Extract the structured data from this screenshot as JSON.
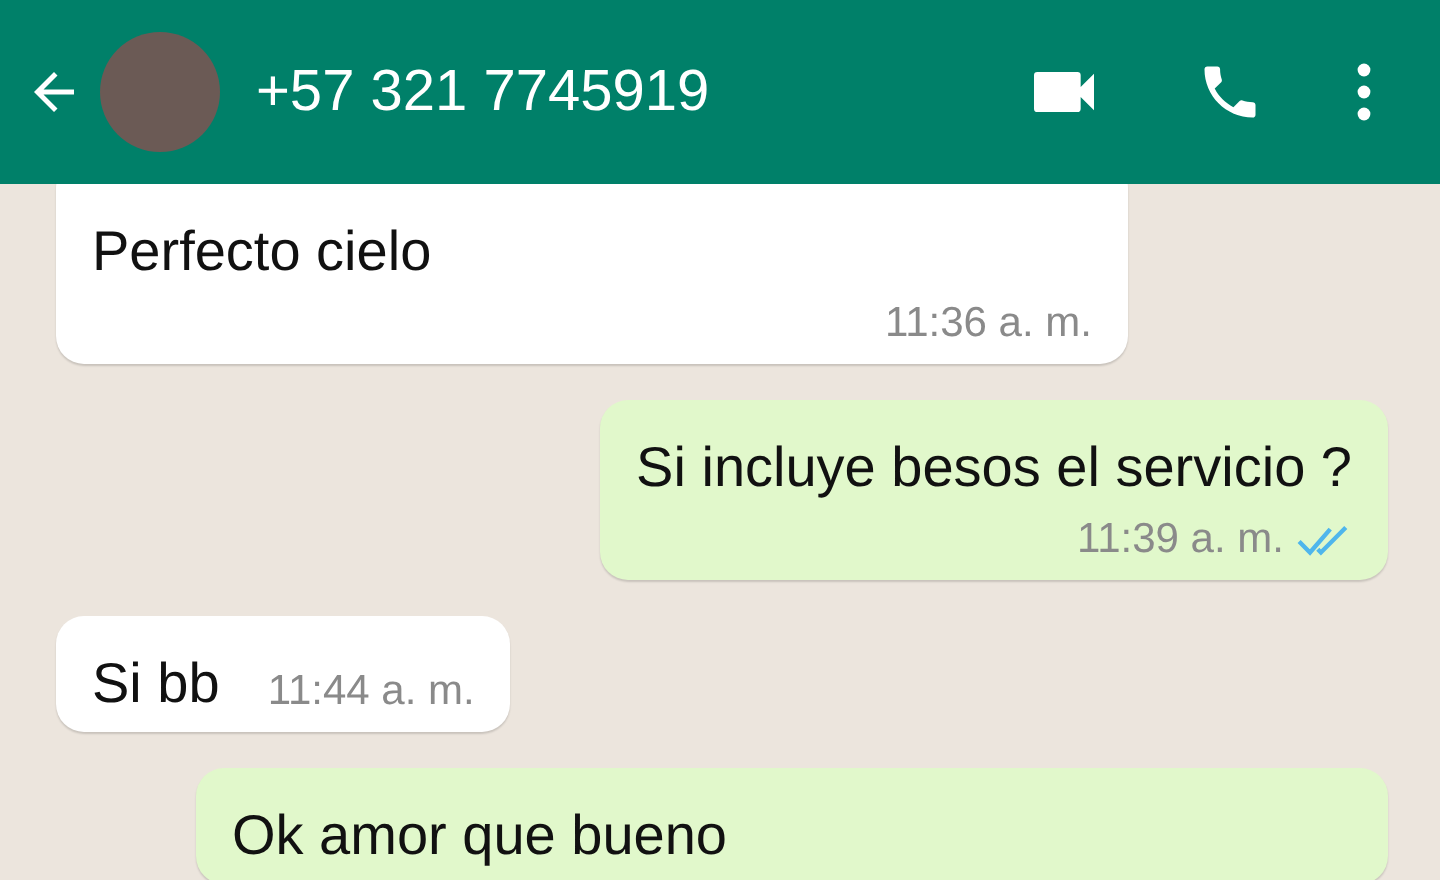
{
  "header": {
    "title": "+57 321 7745919"
  },
  "messages": [
    {
      "kind": "incoming",
      "text": "Perfecto cielo",
      "time": "11:36 a. m."
    },
    {
      "kind": "outgoing",
      "text": "Si incluye besos el servicio ?",
      "time": "11:39 a. m.",
      "read": true
    },
    {
      "kind": "incoming",
      "text": "Si bb",
      "time": "11:44 a. m.",
      "inline_time": true
    },
    {
      "kind": "outgoing",
      "text": "Ok amor que bueno"
    }
  ]
}
